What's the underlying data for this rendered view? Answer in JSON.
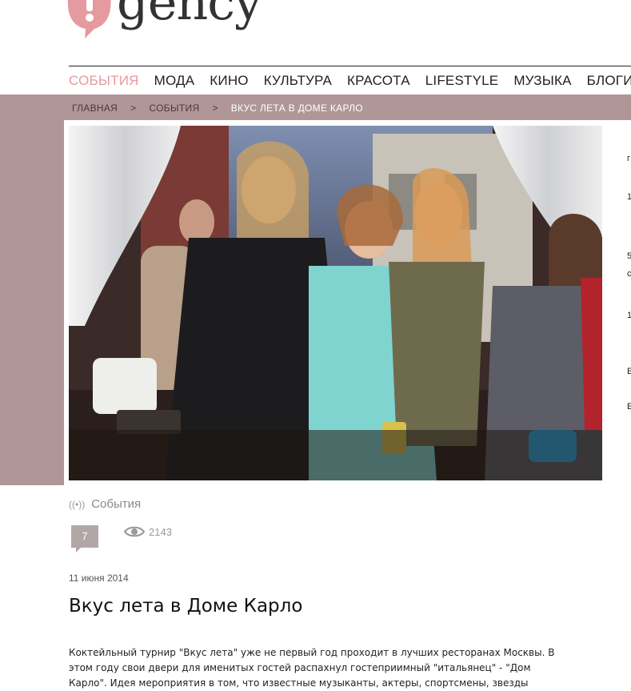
{
  "logo": {
    "text": "gency"
  },
  "nav": {
    "items": [
      "СОБЫТИЯ",
      "МОДА",
      "КИНО",
      "КУЛЬТУРА",
      "КРАСОТА",
      "LIFESTYLE",
      "МУЗЫКА",
      "БЛОГИ"
    ],
    "active": "СОБЫТИЯ"
  },
  "breadcrumb": {
    "home": "ГЛАВНАЯ",
    "section": "СОБЫТИЯ",
    "current": "ВКУС ЛЕТА В ДОМЕ КАРЛО",
    "separator": ">"
  },
  "article": {
    "category": "События",
    "comment_count": "7",
    "views": "2143",
    "date": "11 июня 2014",
    "title": "Вкус лета в Доме Карло",
    "body_line1": "Коктейльный турнир \"Вкус лета\" уже не первый год проходит в лучших ресторанах Москвы. В",
    "body_line2": "этом году свои двери для именитых гостей распахнул гостеприимный \"итальянец\" - \"Дом",
    "body_line3": "Карло\". Идея мероприятия в том, что известные музыканты, актеры, спортсмены, звезды"
  },
  "edge_fragments": [
    "г",
    "1",
    "5",
    "с",
    "1",
    "Е",
    "Е"
  ],
  "colors": {
    "accent": "#e59a9f",
    "band": "#b19697",
    "comment_bubble": "#b2a7a7"
  },
  "icons": {
    "comment": "comment-bubble-icon",
    "views": "eye-icon",
    "category": "broadcast-icon"
  }
}
